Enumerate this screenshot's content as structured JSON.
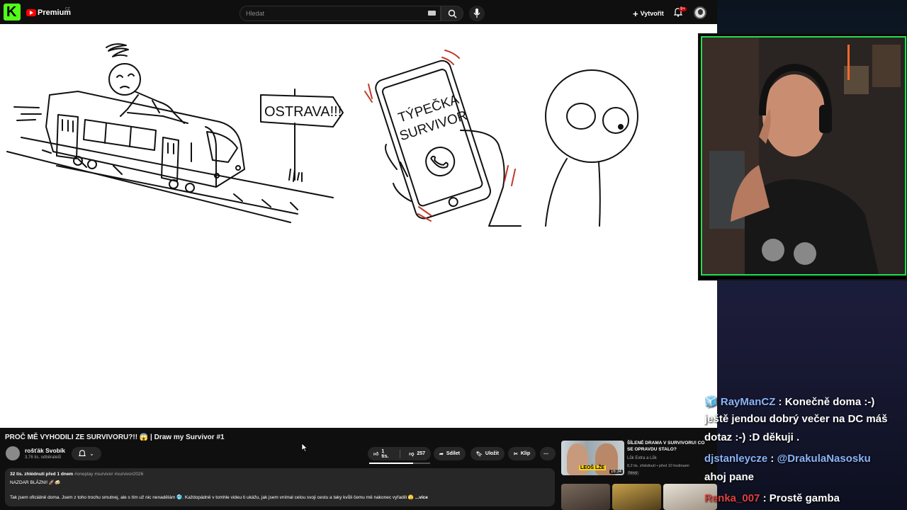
{
  "masthead": {
    "premium_label": "Premium",
    "region": "CZ",
    "search_placeholder": "Hledat",
    "create_label": "Vytvořit",
    "notification_count": "9+"
  },
  "video": {
    "sign_text": "OSTRAVA!!!",
    "phone_text_1": "TÝPEČKA",
    "phone_text_2": "SURVIVOR"
  },
  "watch": {
    "title": "PROČ MĚ VYHODILI ZE SURVIVORU?!! 😱 | Draw my Survivor #1",
    "channel_name": "rošťák Svobík",
    "subscribers": "3,76 tis. odběratelů",
    "likes": "1 tis.",
    "dislikes": "257",
    "share_label": "Sdílet",
    "save_label": "Uložit",
    "clip_label": "Klip",
    "views_date": "32 tis. zhlédnutí  před 1 dnem",
    "tags": "#oneplay #survivor #survivor2026",
    "desc_line1": "NAZDAR BLÁZNI! 🚀🍻",
    "desc_line2": "Tak jsem oficiálně doma. Jsem z toho trochu smutnej, ale s tím už nic nenadělám 🥶. Každopádně v tomhle videu ti ukážu, jak jsem vnímal celou svoji cestu a taky kvůli čemu mě nakonec vyřadili 🫣",
    "more_label": "...více"
  },
  "recommended": {
    "title": "ŠÍLENÉ DRAMA V SURVIVORU! CO SE OPRAVDU STALO?",
    "channel": "Lůk Extra a Lůk",
    "views": "8,2 tis. zhlédnutí • před 10 hodinami",
    "badge": "Nový",
    "duration": "16:34",
    "thumb_label": "LEOŠ LŽE"
  },
  "chat": [
    {
      "user": "RayManCZ",
      "text": "Konečně doma :-)"
    },
    {
      "user": "",
      "text": "ještě jendou dobrý večer na DC máš"
    },
    {
      "user": "",
      "text": "dotaz :-) :D děkuji ."
    },
    {
      "user": "djstanleycze",
      "text": "@DrakulaNasosku"
    },
    {
      "user": "",
      "text": "ahoj pane"
    },
    {
      "user": "Renka_007",
      "text": "Prostě gamba"
    }
  ],
  "colors": {
    "kick_green": "#53fc18",
    "youtube_red": "#ff0000",
    "cam_border": "#20e050"
  }
}
